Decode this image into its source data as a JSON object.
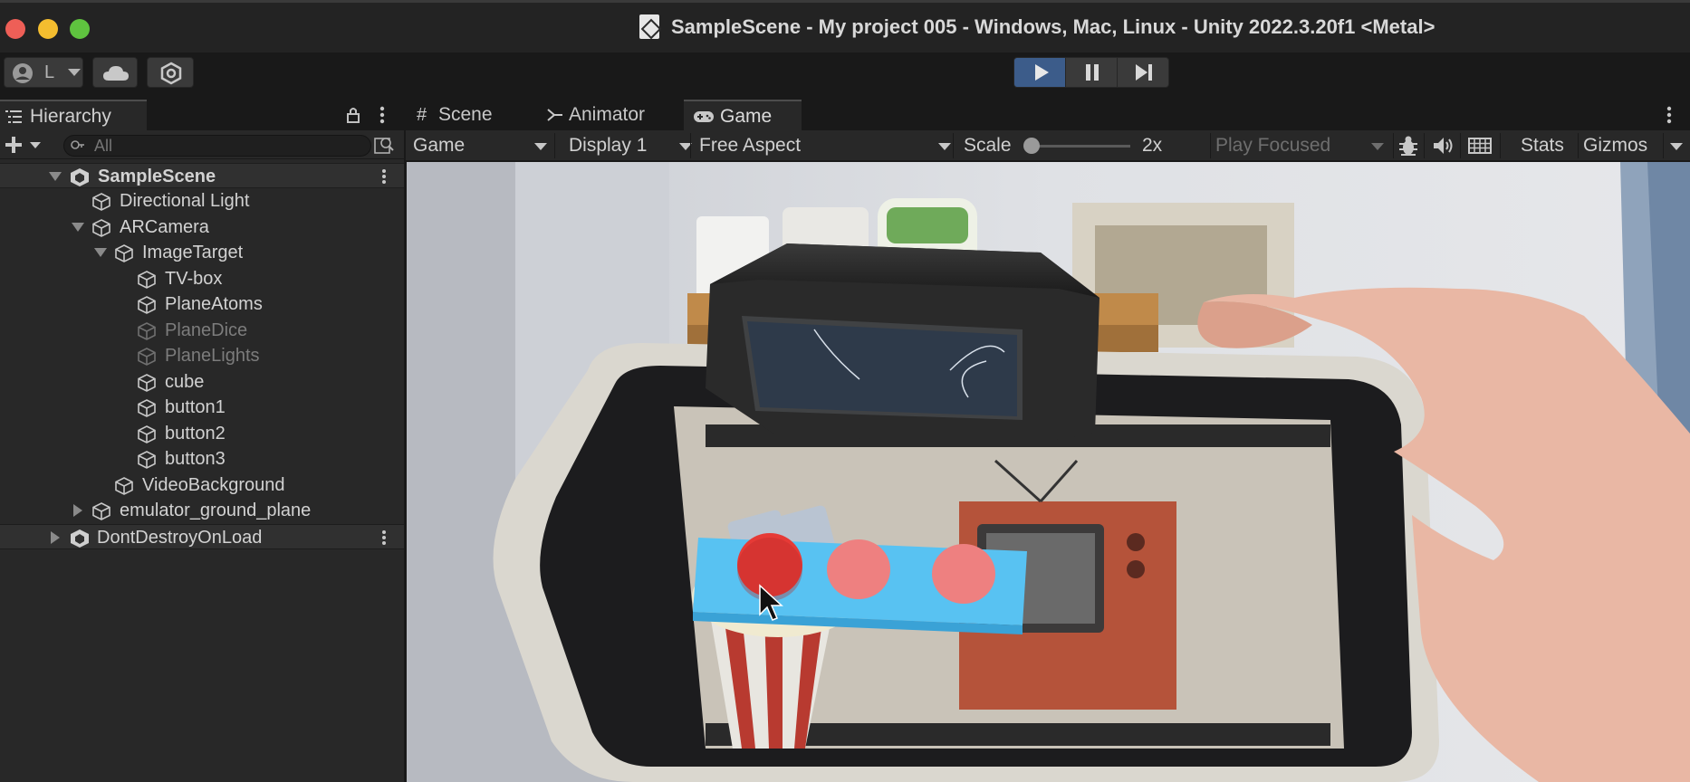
{
  "window": {
    "title": "SampleScene - My project 005 - Windows, Mac, Linux - Unity 2022.3.20f1 <Metal>",
    "traffic_lights": [
      "#ee5f57",
      "#f4bd2f",
      "#5fc33f"
    ]
  },
  "toolbar": {
    "account_label": "L",
    "cloud_icon": "cloud-icon",
    "services_icon": "services-icon",
    "play_icon": "play-icon",
    "pause_icon": "pause-icon",
    "step_icon": "step-icon"
  },
  "hierarchy": {
    "tab_label": "Hierarchy",
    "search_placeholder": "All",
    "items": [
      {
        "label": "SampleScene",
        "type": "scene"
      },
      {
        "label": "Directional Light",
        "type": "object"
      },
      {
        "label": "ARCamera",
        "type": "object"
      },
      {
        "label": "ImageTarget",
        "type": "object"
      },
      {
        "label": "TV-box",
        "type": "object"
      },
      {
        "label": "PlaneAtoms",
        "type": "object"
      },
      {
        "label": "PlaneDice",
        "type": "object",
        "disabled": true
      },
      {
        "label": "PlaneLights",
        "type": "object",
        "disabled": true
      },
      {
        "label": "cube",
        "type": "object"
      },
      {
        "label": "button1",
        "type": "object"
      },
      {
        "label": "button2",
        "type": "object"
      },
      {
        "label": "button3",
        "type": "object"
      },
      {
        "label": "VideoBackground",
        "type": "object"
      },
      {
        "label": "emulator_ground_plane",
        "type": "object"
      },
      {
        "label": "DontDestroyOnLoad",
        "type": "scene"
      }
    ]
  },
  "view_tabs": {
    "scene": "Scene",
    "animator": "Animator",
    "game": "Game"
  },
  "game_controls": {
    "mode": "Game",
    "display": "Display 1",
    "aspect": "Free Aspect",
    "scale_label": "Scale",
    "scale_value": "2x",
    "play_focused": "Play Focused",
    "stats": "Stats",
    "gizmos": "Gizmos"
  },
  "game_view": {
    "buttons": [
      "#e63a36",
      "#ee8080",
      "#ee8080"
    ],
    "base_color": "#58c2f2"
  }
}
